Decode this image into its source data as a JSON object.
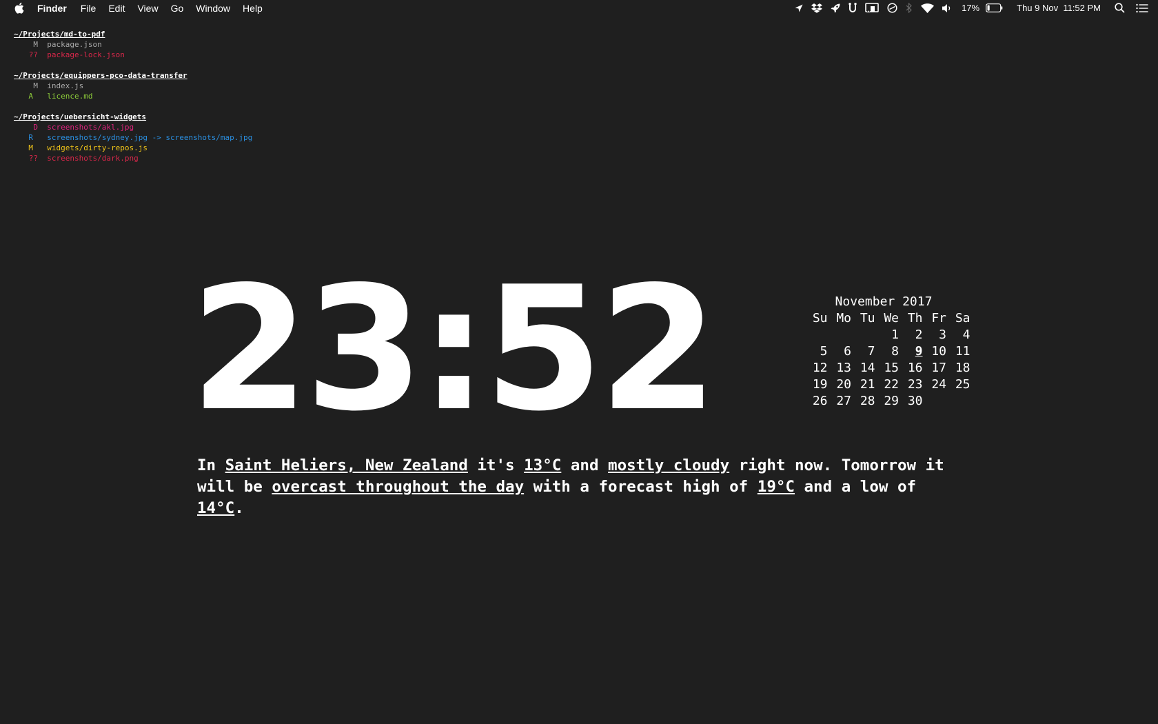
{
  "menubar": {
    "app_name": "Finder",
    "menus": [
      "File",
      "Edit",
      "View",
      "Go",
      "Window",
      "Help"
    ],
    "battery": "17%",
    "datetime": "Thu 9 Nov  11:52 PM"
  },
  "git_widget": {
    "repos": [
      {
        "path": "~/Projects/md-to-pdf",
        "changes": [
          {
            "code": "M",
            "file": "package.json",
            "status": "modified"
          },
          {
            "code": "??",
            "file": "package-lock.json",
            "status": "untracked"
          }
        ]
      },
      {
        "path": "~/Projects/equippers-pco-data-transfer",
        "changes": [
          {
            "code": "M",
            "file": "index.js",
            "status": "modified"
          },
          {
            "code": "A",
            "file": "licence.md",
            "status": "added"
          }
        ]
      },
      {
        "path": "~/Projects/uebersicht-widgets",
        "changes": [
          {
            "code": "D",
            "file": "screenshots/akl.jpg",
            "status": "deleted"
          },
          {
            "code": "R",
            "file": "screenshots/sydney.jpg -> screenshots/map.jpg",
            "status": "renamed"
          },
          {
            "code": "M",
            "file": "widgets/dirty-repos.js",
            "status": "staged-modified"
          },
          {
            "code": "??",
            "file": "screenshots/dark.png",
            "status": "untracked"
          }
        ]
      }
    ],
    "colors": {
      "modified": "#a8a8a8",
      "untracked": "#d8274a",
      "added": "#8dcc3a",
      "deleted": "#e0247e",
      "renamed": "#2b8fe0",
      "staged-modified": "#f0c419"
    }
  },
  "clock": {
    "time": "23:52"
  },
  "calendar": {
    "title": "November 2017",
    "weekdays": [
      "Su",
      "Mo",
      "Tu",
      "We",
      "Th",
      "Fr",
      "Sa"
    ],
    "weeks": [
      [
        "",
        "",
        "",
        "1",
        "2",
        "3",
        "4"
      ],
      [
        "5",
        "6",
        "7",
        "8",
        "9",
        "10",
        "11"
      ],
      [
        "12",
        "13",
        "14",
        "15",
        "16",
        "17",
        "18"
      ],
      [
        "19",
        "20",
        "21",
        "22",
        "23",
        "24",
        "25"
      ],
      [
        "26",
        "27",
        "28",
        "29",
        "30",
        "",
        ""
      ]
    ],
    "today": "9"
  },
  "weather": {
    "p1": "In ",
    "location": "Saint Heliers, New Zealand",
    "p2": " it's ",
    "current_temp": "13°C",
    "p3": " and ",
    "current_condition": "mostly cloudy",
    "p4": " right now. Tomorrow it will be ",
    "tomorrow_condition": "overcast throughout the day",
    "p5": " with a forecast high of ",
    "high": "19°C",
    "p6": " and a low of ",
    "low": "14°C",
    "p7": "."
  },
  "icons": {
    "apple": "apple-icon",
    "location": "location-arrow-icon",
    "dropbox": "dropbox-icon",
    "rocket": "rocket-icon",
    "magnet": "magnet-icon",
    "airplay": "airplay-icon",
    "sync": "time-machine-icon",
    "bluetooth": "bluetooth-icon",
    "wifi": "wifi-icon",
    "volume": "volume-icon",
    "battery": "battery-icon",
    "spotlight": "search-icon",
    "notification_center": "notification-center-icon"
  }
}
